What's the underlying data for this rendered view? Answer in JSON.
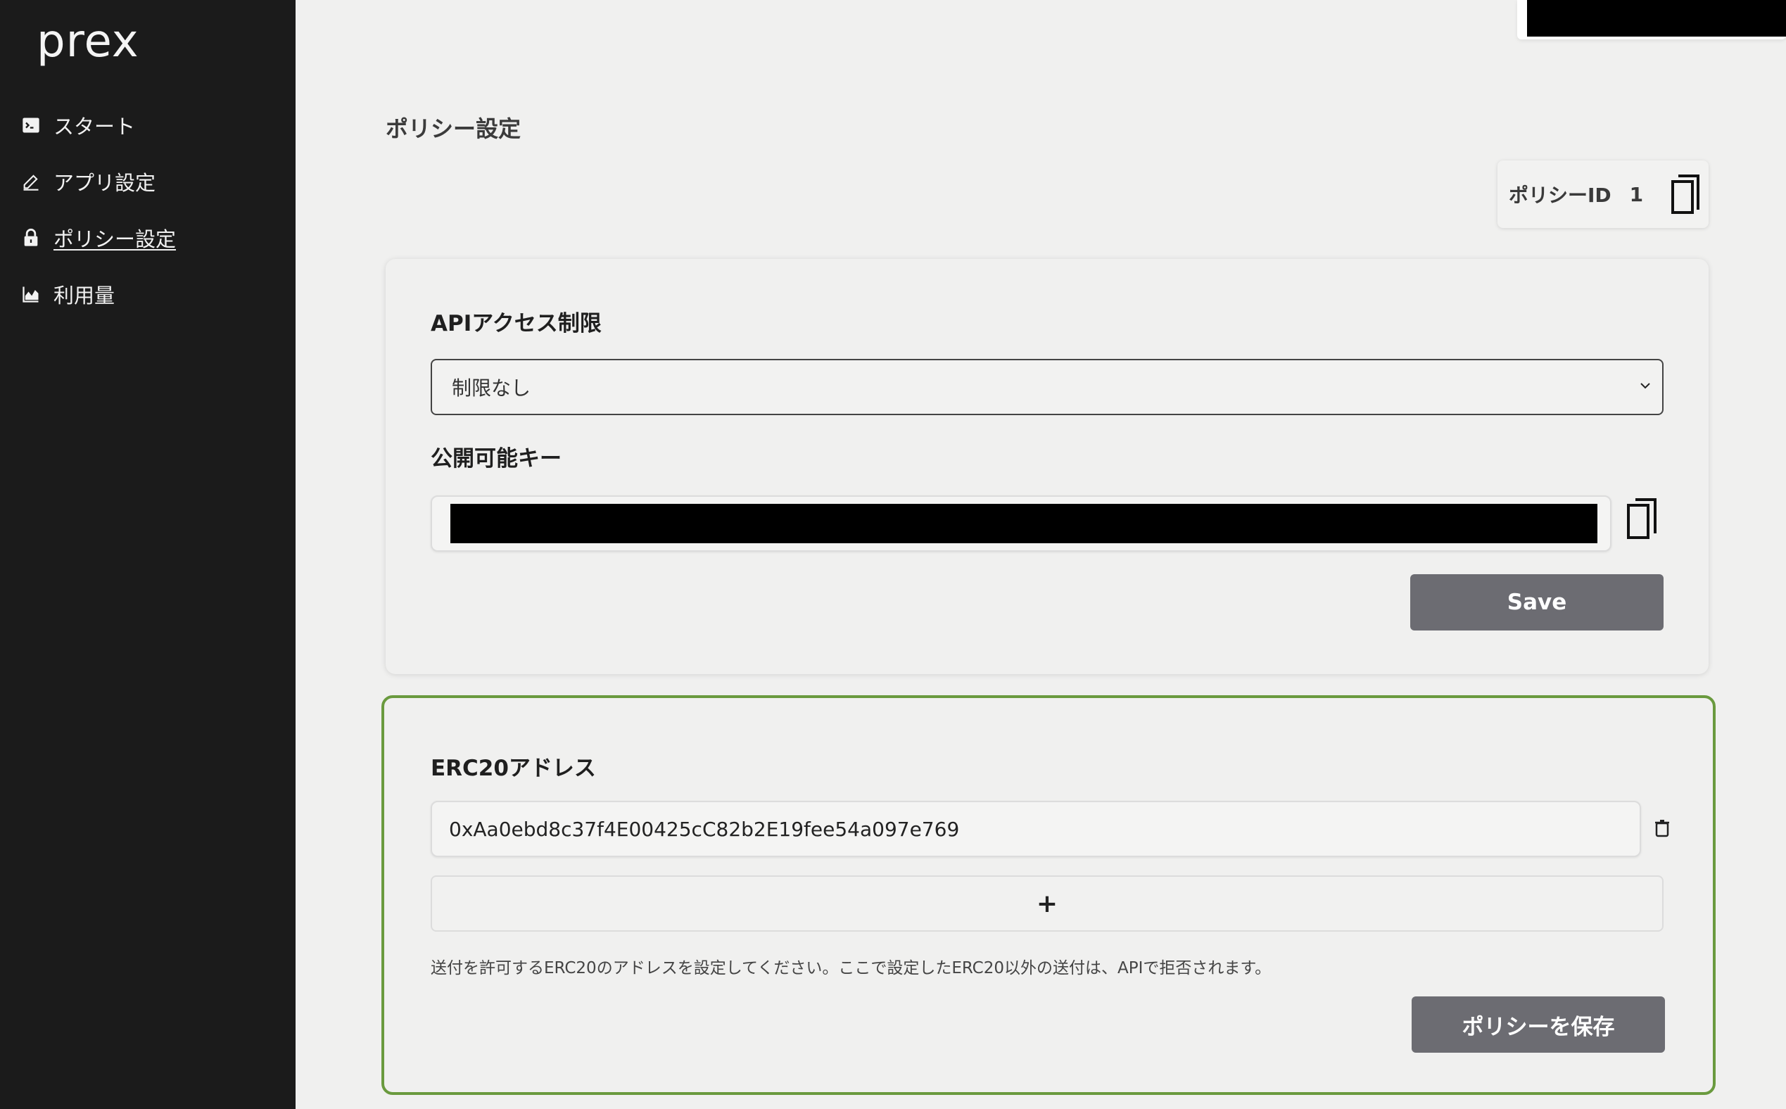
{
  "sidebar": {
    "logo": "prex",
    "items": [
      {
        "label": "スタート",
        "icon": "terminal-icon"
      },
      {
        "label": "アプリ設定",
        "icon": "pencil-icon"
      },
      {
        "label": "ポリシー設定",
        "icon": "lock-icon",
        "active": true
      },
      {
        "label": "利用量",
        "icon": "chart-icon"
      }
    ]
  },
  "main": {
    "page_title": "ポリシー設定",
    "policy_id": {
      "label": "ポリシーID",
      "value": "1"
    },
    "api_section": {
      "title": "APIアクセス制限",
      "select_value": "制限なし",
      "key_title": "公開可能キー",
      "save_label": "Save"
    },
    "erc_section": {
      "title": "ERC20アドレス",
      "addresses": [
        "0xAa0ebd8c37f4E00425cC82b2E19fee54a097e769"
      ],
      "add_label": "+",
      "helper": "送付を許可するERC20のアドレスを設定してください。ここで設定したERC20以外の送付は、APIで拒否されます。",
      "save_label": "ポリシーを保存"
    }
  },
  "colors": {
    "sidebar_bg": "#1b1b1b",
    "page_bg": "#f0f0ef",
    "button_bg": "#6c6c72",
    "highlight_border": "#6a9a3e"
  }
}
